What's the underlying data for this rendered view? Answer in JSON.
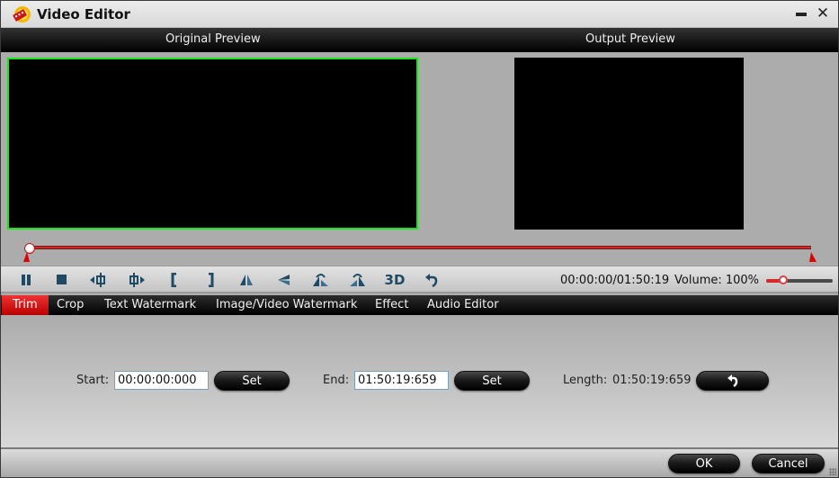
{
  "window": {
    "title": "Video Editor",
    "minimize_icon": "minimize-icon",
    "close_icon": "close-icon",
    "close_glyph": "✕"
  },
  "preview": {
    "original_label": "Original Preview",
    "output_label": "Output Preview",
    "seek_position_fraction": 0.0
  },
  "controls": {
    "buttons": [
      {
        "name": "pause",
        "icon": "pause-icon"
      },
      {
        "name": "stop",
        "icon": "stop-icon"
      },
      {
        "name": "previous-frame",
        "icon": "previous-frame-icon"
      },
      {
        "name": "next-frame",
        "icon": "next-frame-icon"
      },
      {
        "name": "set-start",
        "icon": "left-bracket-icon"
      },
      {
        "name": "set-end",
        "icon": "right-bracket-icon"
      },
      {
        "name": "flip-horizontal",
        "icon": "flip-horizontal-icon"
      },
      {
        "name": "flip-vertical",
        "icon": "flip-vertical-icon"
      },
      {
        "name": "rotate-left",
        "icon": "rotate-left-icon"
      },
      {
        "name": "rotate-right",
        "icon": "rotate-right-icon"
      },
      {
        "name": "3d",
        "icon": "3d-icon",
        "label": "3D"
      },
      {
        "name": "undo",
        "icon": "undo-icon"
      }
    ],
    "time_readout": "00:00:00/01:50:19",
    "volume_label": "Volume:  100%",
    "volume_fraction": 0.25
  },
  "tabs": [
    {
      "label": "Trim",
      "active": true
    },
    {
      "label": "Crop",
      "active": false
    },
    {
      "label": "Text Watermark",
      "active": false
    },
    {
      "label": "Image/Video Watermark",
      "active": false
    },
    {
      "label": "Effect",
      "active": false
    },
    {
      "label": "Audio Editor",
      "active": false
    }
  ],
  "trim": {
    "start_label": "Start:",
    "start_value": "00:00:00:000",
    "start_set_label": "Set",
    "end_label": "End:",
    "end_value": "01:50:19:659",
    "end_set_label": "Set",
    "length_label": "Length:",
    "length_value": "01:50:19:659",
    "reset_icon": "reset-icon"
  },
  "footer": {
    "ok_label": "OK",
    "cancel_label": "Cancel"
  },
  "colors": {
    "accent_red": "#d92525",
    "active_tab_red": "#cc1111",
    "preview_border_green": "#19e619"
  }
}
